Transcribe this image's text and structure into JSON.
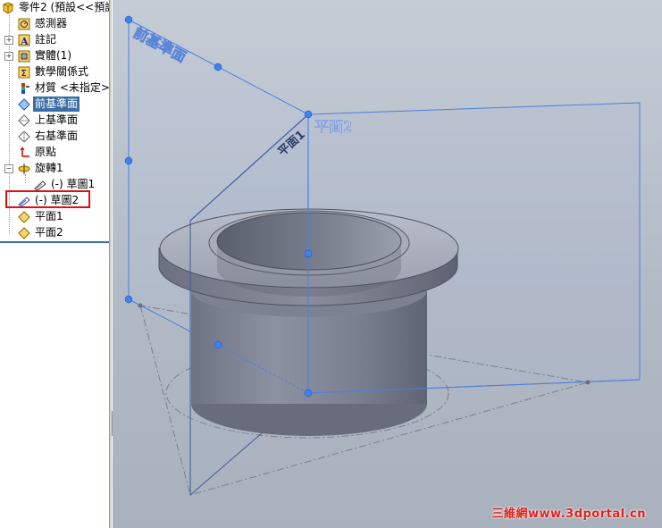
{
  "feature_tree": {
    "root": {
      "label": "零件2 (預設<<預設",
      "icon": "part-icon"
    },
    "items": [
      {
        "label": "感測器",
        "icon": "sensor-icon"
      },
      {
        "label": "註記",
        "icon": "annotation-icon"
      },
      {
        "label": "實體(1)",
        "icon": "solid-bodies-icon"
      },
      {
        "label": "數學關係式",
        "icon": "equations-icon"
      },
      {
        "label": "材質 <未指定>",
        "icon": "material-icon"
      },
      {
        "label": "前基準面",
        "icon": "plane-icon",
        "selected": true
      },
      {
        "label": "上基準面",
        "icon": "plane-icon"
      },
      {
        "label": "右基準面",
        "icon": "plane-icon"
      },
      {
        "label": "原點",
        "icon": "origin-icon"
      },
      {
        "label": "旋轉1",
        "icon": "revolve-icon"
      },
      {
        "label": "(-) 草圖1",
        "icon": "sketch-icon"
      },
      {
        "label": "(-) 草圖2",
        "icon": "sketch-icon",
        "highlighted": true
      },
      {
        "label": "平面1",
        "icon": "plane-feature-icon"
      },
      {
        "label": "平面2",
        "icon": "plane-feature-icon"
      }
    ]
  },
  "viewport": {
    "labels": {
      "front_plane": "前基準面",
      "plane1": "平面1",
      "plane2": "平面2"
    },
    "colors": {
      "plane_line": "#4a7fe0",
      "handle": "#3b82f6",
      "part_body": "#7c8192",
      "selected_item": "#3a6ea5",
      "highlight_box": "#e01010"
    }
  },
  "watermark": "三維網www.3dportal.cn"
}
